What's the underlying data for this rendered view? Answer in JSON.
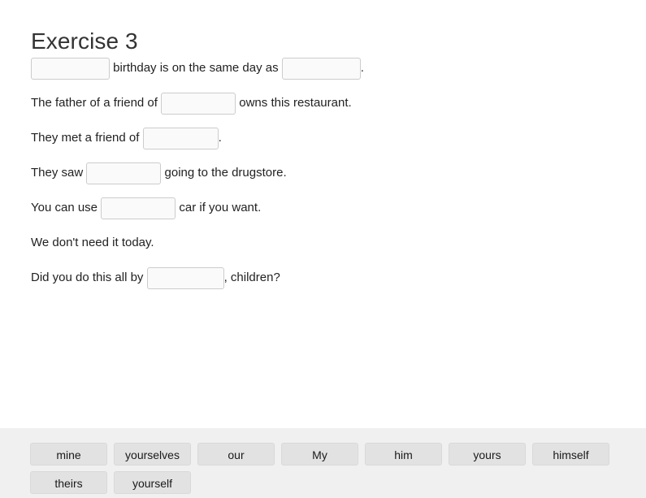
{
  "page": {
    "title": "Exercise 3"
  },
  "sentences": [
    {
      "id": "sentence-1",
      "parts": [
        {
          "type": "blank",
          "value": "",
          "width": "w97"
        },
        {
          "type": "text",
          "text": " birthday is on the same day as "
        },
        {
          "type": "blank",
          "value": "",
          "width": "w97"
        },
        {
          "type": "text",
          "text": "."
        }
      ]
    },
    {
      "id": "sentence-2",
      "parts": [
        {
          "type": "text",
          "text": "The father of a friend of "
        },
        {
          "type": "blank",
          "value": "",
          "width": "w92"
        },
        {
          "type": "text",
          "text": " owns this restaurant."
        }
      ]
    },
    {
      "id": "sentence-3",
      "parts": [
        {
          "type": "text",
          "text": "They met a friend of "
        },
        {
          "type": "blank",
          "value": "",
          "width": "w93"
        },
        {
          "type": "text",
          "text": "."
        }
      ]
    },
    {
      "id": "sentence-4",
      "parts": [
        {
          "type": "text",
          "text": "They saw "
        },
        {
          "type": "blank",
          "value": "",
          "width": "w92"
        },
        {
          "type": "text",
          "text": " going to the drugstore."
        }
      ]
    },
    {
      "id": "sentence-5",
      "parts": [
        {
          "type": "text",
          "text": "You can use "
        },
        {
          "type": "blank",
          "value": "",
          "width": "w92"
        },
        {
          "type": "text",
          "text": " car if you want."
        }
      ]
    },
    {
      "id": "sentence-6",
      "parts": [
        {
          "type": "text",
          "text": "We don't need it today."
        }
      ]
    },
    {
      "id": "sentence-7",
      "parts": [
        {
          "type": "text",
          "text": "Did you do this all by "
        },
        {
          "type": "blank",
          "value": "",
          "width": "w95"
        },
        {
          "type": "text",
          "text": ", children?"
        }
      ]
    }
  ],
  "word_bank": {
    "chips": [
      {
        "label": "mine"
      },
      {
        "label": "yourselves"
      },
      {
        "label": "our"
      },
      {
        "label": "My"
      },
      {
        "label": "him"
      },
      {
        "label": "yours"
      },
      {
        "label": "himself"
      },
      {
        "label": "theirs"
      },
      {
        "label": "yourself"
      }
    ]
  },
  "colors": {
    "page_background": "#ffffff",
    "text": "#222222",
    "heading": "#333333",
    "word_bank_background": "#f0f0f0",
    "chip_background": "#e2e2e2",
    "chip_border": "#d9d9d9",
    "input_border": "#cccccc",
    "input_background": "#fafafa"
  }
}
